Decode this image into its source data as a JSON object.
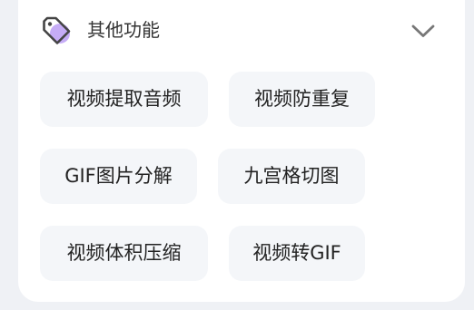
{
  "section": {
    "title": "其他功能",
    "icon": "tag-icon",
    "toggle_icon": "chevron-down-icon",
    "accent": "#b89cf2",
    "icon_stroke": "#444444"
  },
  "features": [
    {
      "label": "视频提取音频"
    },
    {
      "label": "视频防重复"
    },
    {
      "label": "GIF图片分解"
    },
    {
      "label": "九宫格切图"
    },
    {
      "label": "视频体积压缩"
    },
    {
      "label": "视频转GIF"
    }
  ]
}
